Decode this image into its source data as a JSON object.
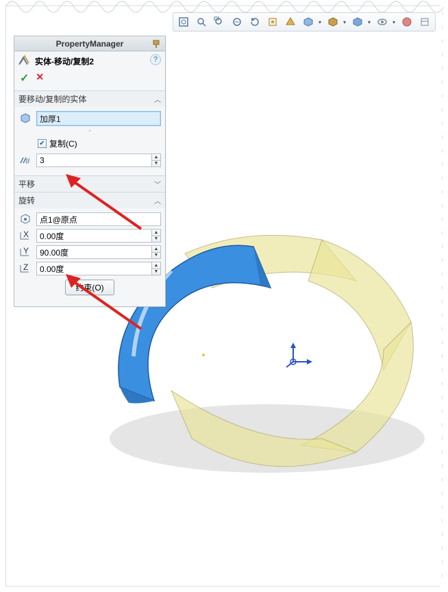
{
  "toolbar": {
    "icons": [
      "zoom-to-fit-icon",
      "zoom-area-icon",
      "zoom-window-icon",
      "zoom-in-out-icon",
      "rotate-icon",
      "pan-icon",
      "sep",
      "view-cube-icon",
      "section-icon",
      "display-style-icon",
      "hide-show-icon",
      "sep",
      "appearance-icon",
      "scene-icon",
      "render-icon"
    ]
  },
  "pm": {
    "title": "PropertyManager",
    "feature_name": "实体-移动/复制2",
    "help_tooltip": "?",
    "sections": {
      "bodies": {
        "title": "要移动/复制的实体",
        "selected": "加厚1",
        "copy_label": "复制(C)",
        "copy_checked": true,
        "count_value": "3"
      },
      "translate": {
        "title": "平移"
      },
      "rotate": {
        "title": "旋转",
        "ref_point": "点1@原点",
        "x_value": "0.00度",
        "y_value": "90.00度",
        "z_value": "0.00度"
      }
    },
    "constrain_btn": "约束(O)"
  }
}
